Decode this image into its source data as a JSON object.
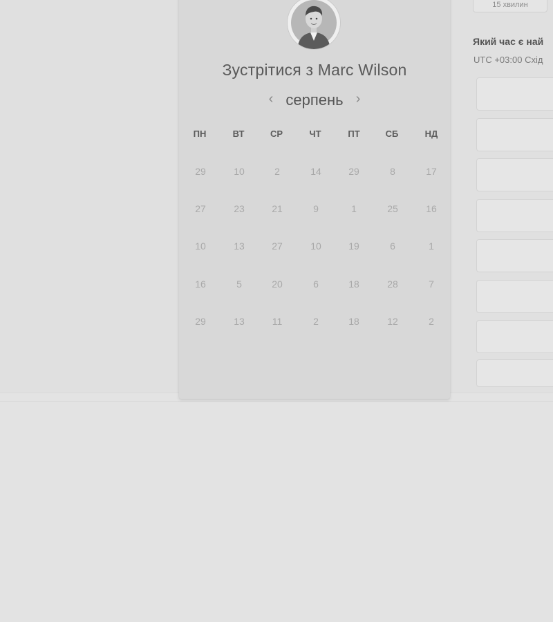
{
  "calendar": {
    "title": "Зустрітися з Marc Wilson",
    "month": "серпень",
    "prev_label": "‹",
    "next_label": "›",
    "weekdays": [
      "ПН",
      "ВТ",
      "СР",
      "ЧТ",
      "ПТ",
      "СБ",
      "НД"
    ],
    "weeks": [
      [
        "29",
        "10",
        "2",
        "14",
        "29",
        "8",
        "17"
      ],
      [
        "27",
        "23",
        "21",
        "9",
        "1",
        "25",
        "16"
      ],
      [
        "10",
        "13",
        "27",
        "10",
        "19",
        "6",
        "1"
      ],
      [
        "16",
        "5",
        "20",
        "6",
        "18",
        "28",
        "7"
      ],
      [
        "29",
        "13",
        "11",
        "2",
        "18",
        "12",
        "2"
      ]
    ]
  },
  "scheduler": {
    "duration": "15 хвилин",
    "question": "Який час є най",
    "timezone": "UTC +03:00 Схід"
  },
  "icons": {
    "avatar": "person-photo",
    "prev": "chevron-left-icon",
    "next": "chevron-right-icon"
  }
}
